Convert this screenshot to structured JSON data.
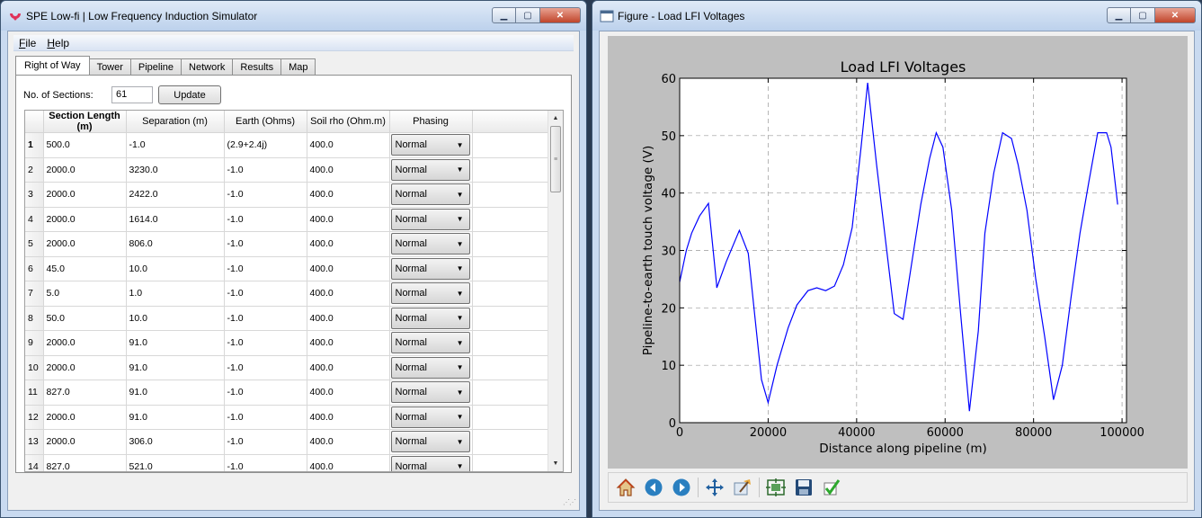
{
  "left_window": {
    "title": "SPE Low-fi | Low Frequency Induction Simulator",
    "controls": {
      "minimize": "▁",
      "maximize": "▢",
      "close": "✕"
    },
    "menu": [
      {
        "label": "File",
        "accel": "F",
        "rest": "ile"
      },
      {
        "label": "Help",
        "accel": "H",
        "rest": "elp"
      }
    ],
    "tabs": [
      "Right of Way",
      "Tower",
      "Pipeline",
      "Network",
      "Results",
      "Map"
    ],
    "active_tab": "Right of Way",
    "sections": {
      "label": "No. of Sections:",
      "value": "61",
      "update_label": "Update"
    },
    "table": {
      "columns": [
        "Section Length (m)",
        "Separation (m)",
        "Earth (Ohms)",
        "Soil rho (Ohm.m)",
        "Phasing"
      ],
      "rows": [
        {
          "n": "1",
          "length": "500.0",
          "separation": "-1.0",
          "earth": "(2.9+2.4j)",
          "soil": "400.0",
          "phasing": "Normal"
        },
        {
          "n": "2",
          "length": "2000.0",
          "separation": "3230.0",
          "earth": "-1.0",
          "soil": "400.0",
          "phasing": "Normal"
        },
        {
          "n": "3",
          "length": "2000.0",
          "separation": "2422.0",
          "earth": "-1.0",
          "soil": "400.0",
          "phasing": "Normal"
        },
        {
          "n": "4",
          "length": "2000.0",
          "separation": "1614.0",
          "earth": "-1.0",
          "soil": "400.0",
          "phasing": "Normal"
        },
        {
          "n": "5",
          "length": "2000.0",
          "separation": "806.0",
          "earth": "-1.0",
          "soil": "400.0",
          "phasing": "Normal"
        },
        {
          "n": "6",
          "length": "45.0",
          "separation": "10.0",
          "earth": "-1.0",
          "soil": "400.0",
          "phasing": "Normal"
        },
        {
          "n": "7",
          "length": "5.0",
          "separation": "1.0",
          "earth": "-1.0",
          "soil": "400.0",
          "phasing": "Normal"
        },
        {
          "n": "8",
          "length": "50.0",
          "separation": "10.0",
          "earth": "-1.0",
          "soil": "400.0",
          "phasing": "Normal"
        },
        {
          "n": "9",
          "length": "2000.0",
          "separation": "91.0",
          "earth": "-1.0",
          "soil": "400.0",
          "phasing": "Normal"
        },
        {
          "n": "10",
          "length": "2000.0",
          "separation": "91.0",
          "earth": "-1.0",
          "soil": "400.0",
          "phasing": "Normal"
        },
        {
          "n": "11",
          "length": "827.0",
          "separation": "91.0",
          "earth": "-1.0",
          "soil": "400.0",
          "phasing": "Normal"
        },
        {
          "n": "12",
          "length": "2000.0",
          "separation": "91.0",
          "earth": "-1.0",
          "soil": "400.0",
          "phasing": "Normal"
        },
        {
          "n": "13",
          "length": "2000.0",
          "separation": "306.0",
          "earth": "-1.0",
          "soil": "400.0",
          "phasing": "Normal"
        },
        {
          "n": "14",
          "length": "827.0",
          "separation": "521.0",
          "earth": "-1.0",
          "soil": "400.0",
          "phasing": "Normal"
        }
      ]
    }
  },
  "right_window": {
    "title": "Figure - Load LFI Voltages",
    "toolbar": [
      "home-icon",
      "back-icon",
      "forward-icon",
      "pan-icon",
      "zoom-icon",
      "subplots-icon",
      "save-icon",
      "check-icon"
    ]
  },
  "chart_data": {
    "type": "line",
    "title": "Load LFI Voltages",
    "xlabel": "Distance along pipeline (m)",
    "ylabel": "Pipeline-to-earth touch voltage (V)",
    "xlim": [
      0,
      101000
    ],
    "ylim": [
      0,
      60
    ],
    "xticks": [
      0,
      20000,
      40000,
      60000,
      80000,
      100000
    ],
    "yticks": [
      0,
      10,
      20,
      30,
      40,
      50,
      60
    ],
    "grid": true,
    "line_color": "#0000ff",
    "x": [
      0,
      1500,
      2700,
      4500,
      6500,
      8300,
      8400,
      10500,
      13500,
      15500,
      18500,
      20000,
      22000,
      24500,
      26500,
      29000,
      31000,
      33000,
      35000,
      37000,
      39000,
      41000,
      42500,
      44500,
      46500,
      48500,
      50500,
      52500,
      54500,
      56500,
      58000,
      59500,
      61500,
      63500,
      65500,
      67500,
      69000,
      71000,
      73000,
      75000,
      76500,
      78500,
      80500,
      82500,
      84500,
      86500,
      88500,
      90500,
      92500,
      94500,
      96500,
      97500,
      99000,
      101000
    ],
    "y": [
      24.5,
      30,
      33,
      36,
      38.2,
      24.5,
      23.5,
      28,
      33.5,
      29.5,
      7.5,
      3.5,
      10,
      16.5,
      20.5,
      23,
      23.5,
      23,
      23.8,
      27.5,
      34,
      48,
      59.2,
      45,
      32,
      19,
      18,
      28,
      38,
      46,
      50.5,
      48,
      37,
      19,
      2,
      16,
      33,
      43.5,
      50.5,
      49.5,
      45,
      37,
      25,
      15,
      4,
      10,
      22,
      33,
      42,
      50.5,
      50.5,
      48,
      38
    ]
  }
}
